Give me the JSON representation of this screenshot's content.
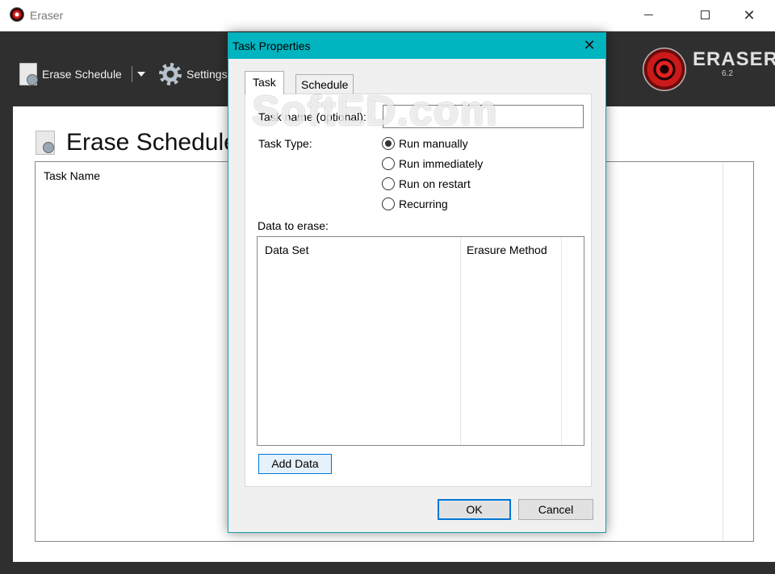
{
  "window": {
    "title": "Eraser",
    "minimize_icon": "minimize-icon",
    "maximize_icon": "maximize-icon",
    "close_icon": "close-icon"
  },
  "toolbar": {
    "erase_schedule_label": "Erase Schedule",
    "settings_label": "Settings"
  },
  "logo": {
    "name": "ERASER",
    "version": "6.2"
  },
  "main": {
    "page_title": "Erase Schedule",
    "list_columns": [
      "Task Name"
    ]
  },
  "dialog": {
    "title": "Task Properties",
    "tabs": [
      {
        "label": "Task",
        "selected": true
      },
      {
        "label": "Schedule",
        "selected": false
      }
    ],
    "task_name_label": "Task name (optional):",
    "task_name_value": "",
    "task_type_label": "Task Type:",
    "task_types": [
      {
        "label": "Run manually",
        "checked": true
      },
      {
        "label": "Run immediately",
        "checked": false
      },
      {
        "label": "Run on restart",
        "checked": false
      },
      {
        "label": "Recurring",
        "checked": false
      }
    ],
    "data_to_erase_label": "Data to erase:",
    "data_columns": [
      "Data Set",
      "Erasure Method"
    ],
    "add_data_label": "Add Data",
    "ok_label": "OK",
    "cancel_label": "Cancel"
  },
  "watermark": "SoftED.com",
  "colors": {
    "dialog_title_bar": "#00b4c0",
    "dark_background": "#2f2f2f",
    "button_focus": "#0078d7"
  }
}
